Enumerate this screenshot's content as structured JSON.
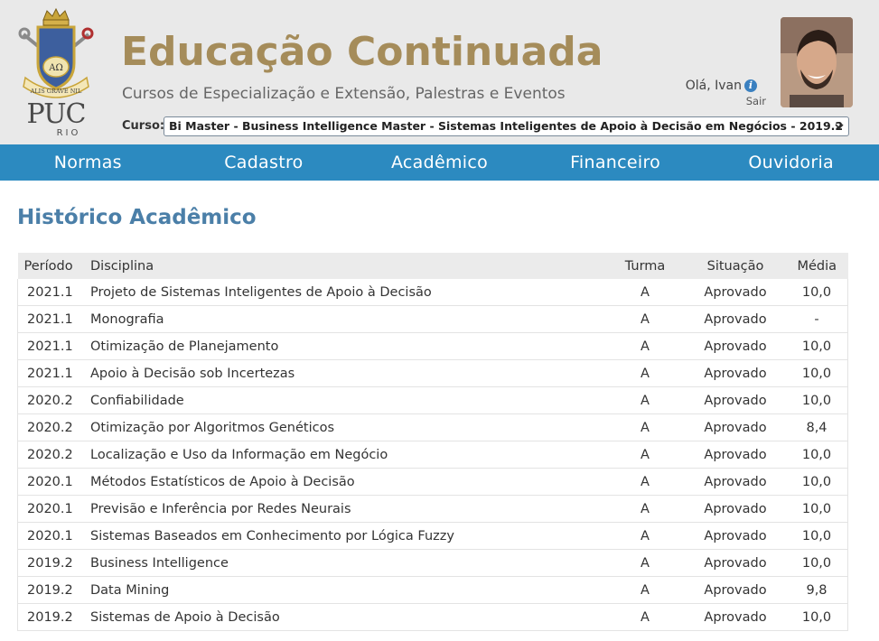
{
  "header": {
    "logo_text": "PUC",
    "logo_sub": "RIO",
    "logo_motto": "ALIS GRAVE NIL",
    "title": "Educação Continuada",
    "subtitle": "Cursos de Especialização e Extensão, Palestras e Eventos",
    "course_label": "Curso:",
    "course_selected": "Bi Master - Business Intelligence Master - Sistemas Inteligentes de Apoio à Decisão em Negócios - 2019.2",
    "greeting": "Olá, Ivan",
    "logout": "Sair"
  },
  "nav": [
    "Normas",
    "Cadastro",
    "Acadêmico",
    "Financeiro",
    "Ouvidoria"
  ],
  "page_title": "Histórico Acadêmico",
  "table": {
    "headers": [
      "Período",
      "Disciplina",
      "Turma",
      "Situação",
      "Média"
    ],
    "rows": [
      [
        "2021.1",
        "Projeto de Sistemas Inteligentes de Apoio à Decisão",
        "A",
        "Aprovado",
        "10,0"
      ],
      [
        "2021.1",
        "Monografia",
        "A",
        "Aprovado",
        "-"
      ],
      [
        "2021.1",
        "Otimização de Planejamento",
        "A",
        "Aprovado",
        "10,0"
      ],
      [
        "2021.1",
        "Apoio à Decisão sob Incertezas",
        "A",
        "Aprovado",
        "10,0"
      ],
      [
        "2020.2",
        "Confiabilidade",
        "A",
        "Aprovado",
        "10,0"
      ],
      [
        "2020.2",
        "Otimização por Algoritmos Genéticos",
        "A",
        "Aprovado",
        "8,4"
      ],
      [
        "2020.2",
        "Localização e Uso da Informação em Negócio",
        "A",
        "Aprovado",
        "10,0"
      ],
      [
        "2020.1",
        "Métodos Estatísticos de Apoio à Decisão",
        "A",
        "Aprovado",
        "10,0"
      ],
      [
        "2020.1",
        "Previsão e Inferência por Redes Neurais",
        "A",
        "Aprovado",
        "10,0"
      ],
      [
        "2020.1",
        "Sistemas Baseados em Conhecimento por Lógica Fuzzy",
        "A",
        "Aprovado",
        "10,0"
      ],
      [
        "2019.2",
        "Business Intelligence",
        "A",
        "Aprovado",
        "10,0"
      ],
      [
        "2019.2",
        "Data Mining",
        "A",
        "Aprovado",
        "9,8"
      ],
      [
        "2019.2",
        "Sistemas de Apoio à Decisão",
        "A",
        "Aprovado",
        "10,0"
      ]
    ]
  },
  "colors": {
    "header_bg": "#e9e9e9",
    "title": "#a58c5a",
    "nav_bg": "#2c8ac0",
    "page_title": "#4b7fa8"
  }
}
